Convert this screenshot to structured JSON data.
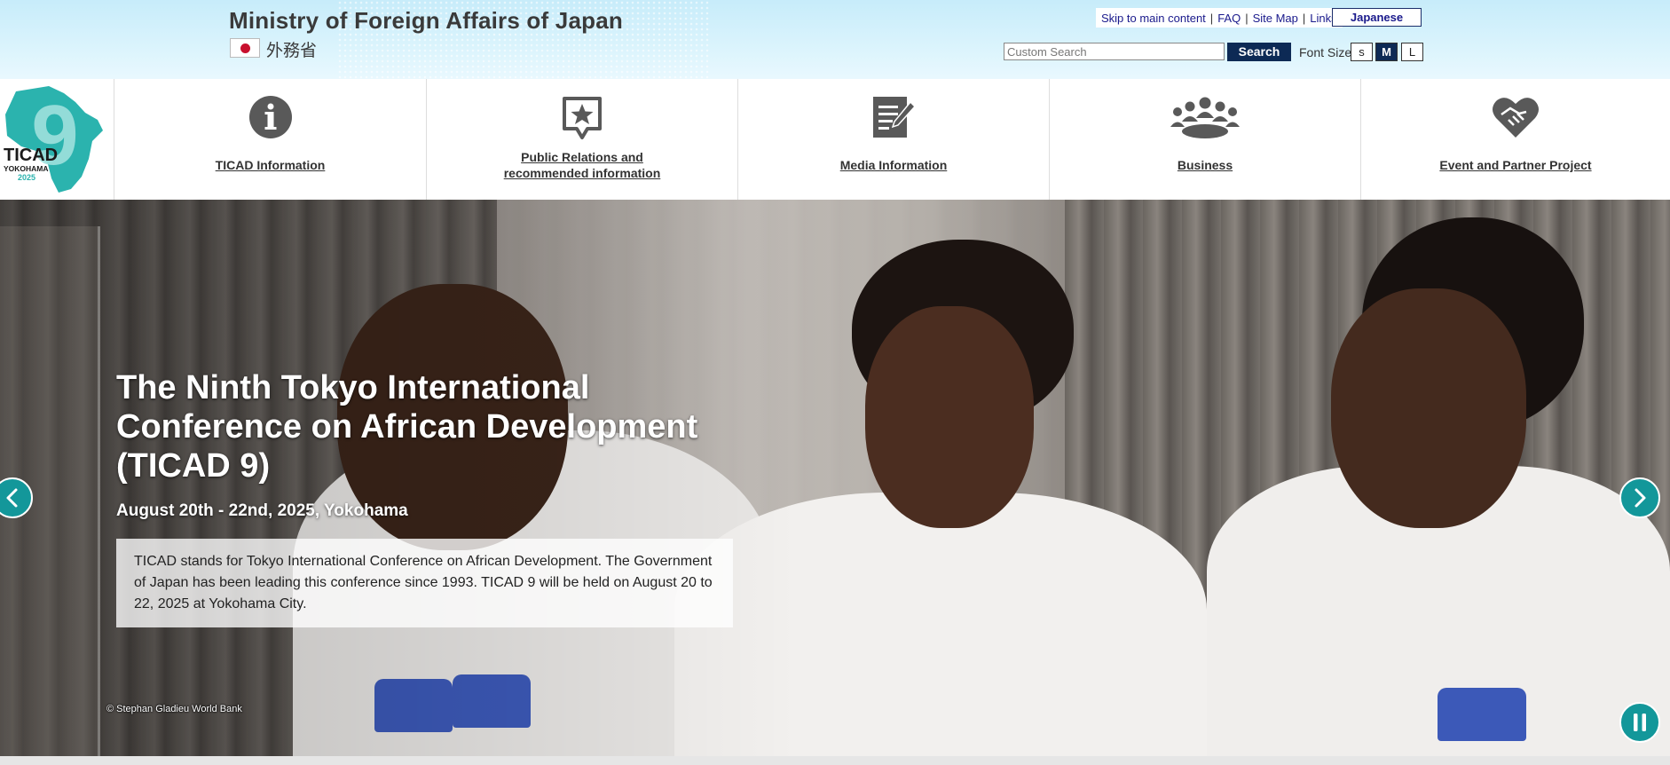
{
  "header": {
    "ministry_title": "Ministry of Foreign Affairs of Japan",
    "ministry_title_jp": "外務省",
    "links": [
      {
        "label": "Skip to main content"
      },
      {
        "label": "FAQ"
      },
      {
        "label": "Site Map"
      },
      {
        "label": "Links"
      }
    ],
    "link_separator": "|",
    "japanese_label": "Japanese",
    "search": {
      "placeholder": "Custom Search",
      "button_label": "Search"
    },
    "font_size": {
      "label": "Font Size",
      "options": [
        "s",
        "M",
        "L"
      ],
      "selected": "M"
    }
  },
  "logo": {
    "name": "TICAD",
    "number": "9",
    "city": "YOKOHAMA",
    "year": "2025"
  },
  "nav": {
    "items": [
      {
        "label": "TICAD Information",
        "icon": "info-icon"
      },
      {
        "label": "Public Relations and recommended information",
        "line1": "Public Relations and",
        "line2": "recommended information",
        "icon": "star-speech-bubble-icon"
      },
      {
        "label": "Media Information",
        "icon": "document-edit-icon"
      },
      {
        "label": "Business",
        "icon": "group-meeting-icon"
      },
      {
        "label": "Event and Partner Project",
        "icon": "heart-handshake-icon"
      }
    ]
  },
  "hero": {
    "title": "The Ninth Tokyo International Conference on African Development (TICAD 9)",
    "date": "August 20th - 22nd, 2025, Yokohama",
    "description": "TICAD stands for Tokyo International Conference on African Development. The Government of Japan has been leading this conference since 1993. TICAD 9 will be held on August 20 to 22, 2025 at Yokohama City.",
    "photo_credit": "© Stephan Gladieu World Bank",
    "accent_color": "#13979a"
  },
  "colors": {
    "brand_navy": "#0d2a55",
    "link_blue": "#1a1a8c",
    "nav_icon_gray": "#595959",
    "ticad_teal": "#2bb3ae"
  }
}
